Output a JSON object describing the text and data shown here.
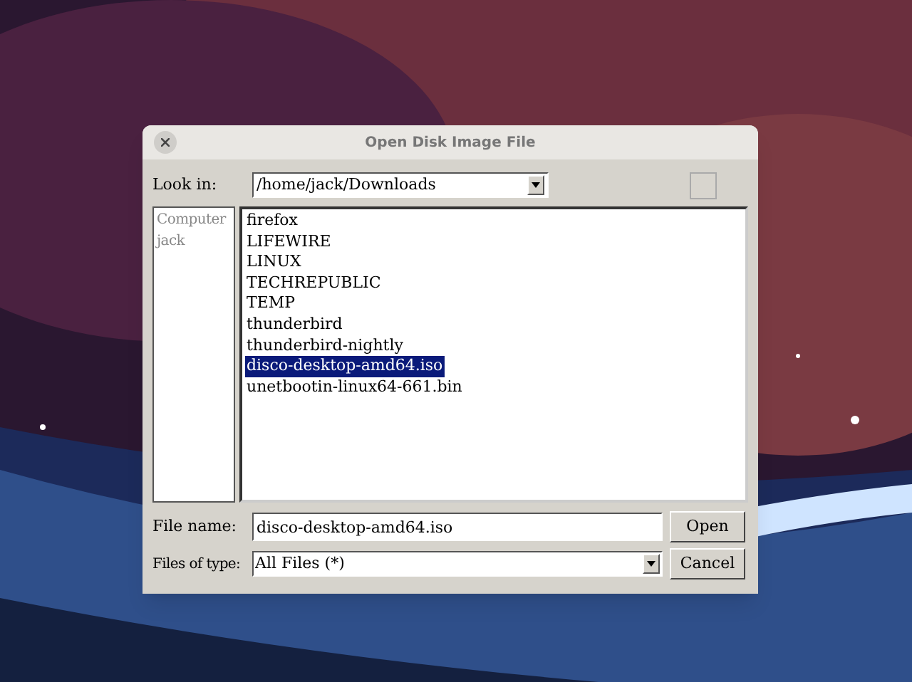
{
  "window": {
    "title": "Open Disk Image File"
  },
  "look_in": {
    "label": "Look in:",
    "value": "/home/jack/Downloads"
  },
  "places": [
    "Computer",
    "jack"
  ],
  "files": [
    {
      "name": "firefox",
      "selected": false
    },
    {
      "name": "LIFEWIRE",
      "selected": false
    },
    {
      "name": "LINUX",
      "selected": false
    },
    {
      "name": "TECHREPUBLIC",
      "selected": false
    },
    {
      "name": "TEMP",
      "selected": false
    },
    {
      "name": "thunderbird",
      "selected": false
    },
    {
      "name": "thunderbird-nightly",
      "selected": false
    },
    {
      "name": "disco-desktop-amd64.iso",
      "selected": true
    },
    {
      "name": "unetbootin-linux64-661.bin",
      "selected": false
    }
  ],
  "file_name": {
    "label": "File name:",
    "value": "disco-desktop-amd64.iso"
  },
  "file_type": {
    "label": "Files of type:",
    "value": "All Files (*)"
  },
  "buttons": [
    "Open",
    "Cancel"
  ]
}
